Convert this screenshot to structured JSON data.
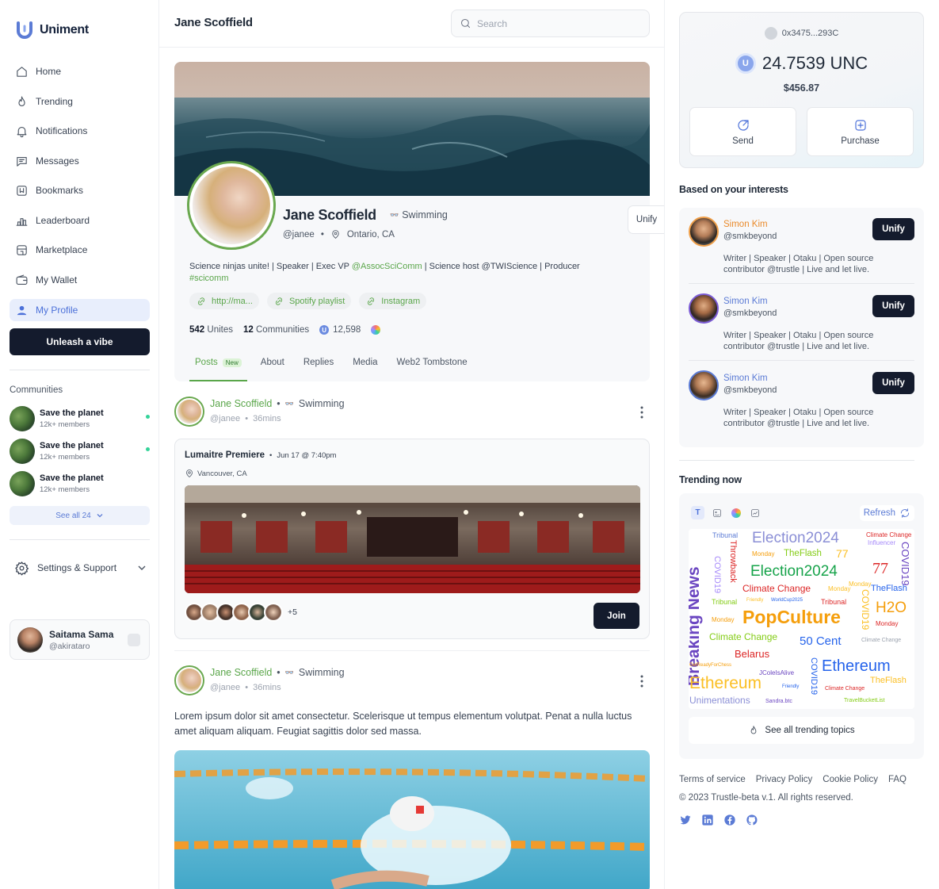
{
  "app": {
    "name": "Uniment"
  },
  "sidebar": {
    "nav": [
      {
        "label": "Home",
        "icon": "home-icon"
      },
      {
        "label": "Trending",
        "icon": "flame-icon"
      },
      {
        "label": "Notifications",
        "icon": "bell-icon"
      },
      {
        "label": "Messages",
        "icon": "message-icon"
      },
      {
        "label": "Bookmarks",
        "icon": "bookmark-icon"
      },
      {
        "label": "Leaderboard",
        "icon": "leaderboard-icon"
      },
      {
        "label": "Marketplace",
        "icon": "store-icon"
      },
      {
        "label": "My Wallet",
        "icon": "wallet-icon"
      },
      {
        "label": "My Profile",
        "icon": "user-icon"
      }
    ],
    "cta": "Unleash a vibe",
    "communities_title": "Communities",
    "communities": [
      {
        "name": "Save the planet",
        "members": "12k+ members",
        "online": true
      },
      {
        "name": "Save the planet",
        "members": "12k+ members",
        "online": true
      },
      {
        "name": "Save the planet",
        "members": "12k+ members",
        "online": false
      }
    ],
    "see_all": "See all 24",
    "settings": "Settings & Support",
    "user": {
      "name": "Saitama Sama",
      "handle": "@akirataro"
    }
  },
  "header": {
    "title": "Jane Scoffield",
    "search_placeholder": "Search"
  },
  "profile": {
    "name": "Jane Scoffield",
    "tag": "Swimming",
    "handle": "@janee",
    "location": "Ontario, CA",
    "unify": "Unify",
    "bio": {
      "part1": "Science ninjas unite! | Speaker | Exec VP ",
      "mention": "@AssocSciComm",
      "part2": " | Science host @TWIScience | Producer",
      "hashtag": "#scicomm"
    },
    "links": [
      "http://ma...",
      "Spotify playlist",
      "Instagram"
    ],
    "stats": {
      "unites": "542",
      "unites_label": "Unites",
      "communities": "12",
      "communities_label": "Communities",
      "tokens": "12,598"
    },
    "tabs": [
      "Posts",
      "About",
      "Replies",
      "Media",
      "Web2 Tombstone"
    ],
    "new_badge": "New"
  },
  "posts": [
    {
      "author": "Jane Scoffield",
      "tag": "Swimming",
      "handle": "@janee",
      "time": "36mins",
      "event": {
        "title": "Lumaitre Premiere",
        "date": "Jun 17 @ 7:40pm",
        "location": "Vancouver, CA",
        "more": "+5",
        "join": "Join"
      }
    },
    {
      "author": "Jane Scoffield",
      "tag": "Swimming",
      "handle": "@janee",
      "time": "36mins",
      "text": "Lorem ipsum dolor sit amet consectetur. Scelerisque ut tempus elementum volutpat. Penat a nulla luctus amet aliquam aliquam. Feugiat sagittis dolor sed massa."
    }
  ],
  "wallet": {
    "address": "0x3475...293C",
    "balance": "24.7539 UNC",
    "usd": "$456.87",
    "send": "Send",
    "purchase": "Purchase"
  },
  "interests": {
    "title": "Based on your interests",
    "items": [
      {
        "name": "Simon Kim",
        "handle": "@smkbeyond",
        "bio": "Writer | Speaker | Otaku | Open source contributor @trustle | Live and let live.",
        "button": "Unify"
      },
      {
        "name": "Simon Kim",
        "handle": "@smkbeyond",
        "bio": "Writer | Speaker | Otaku | Open source contributor @trustle | Live and let live.",
        "button": "Unify"
      },
      {
        "name": "Simon Kim",
        "handle": "@smkbeyond",
        "bio": "Writer | Speaker | Otaku | Open source contributor @trustle | Live and let live.",
        "button": "Unify"
      }
    ]
  },
  "trending": {
    "title": "Trending now",
    "refresh": "Refresh",
    "tool_t": "T",
    "see_all": "See all trending topics",
    "cloud": [
      {
        "t": "Breaking News",
        "c": "#6b46c1"
      },
      {
        "t": "Tribunal",
        "c": "#5b7bd5"
      },
      {
        "t": "Election2024",
        "c": "#8b8fd6"
      },
      {
        "t": "Climate Change",
        "c": "#dc2626"
      },
      {
        "t": "Monday",
        "c": "#f59e0b"
      },
      {
        "t": "TheFlash",
        "c": "#84cc16"
      },
      {
        "t": "77",
        "c": "#fbbf24"
      },
      {
        "t": "Influencer",
        "c": "#a78bfa"
      },
      {
        "t": "COVID19",
        "c": "#6b46c1"
      },
      {
        "t": "COVID19",
        "c": "#a78bfa"
      },
      {
        "t": "Throwback",
        "c": "#dc2626"
      },
      {
        "t": "Election2024",
        "c": "#16a34a"
      },
      {
        "t": "77",
        "c": "#dc2626"
      },
      {
        "t": "Monday",
        "c": "#fbbf24"
      },
      {
        "t": "TheFlash",
        "c": "#2563eb"
      },
      {
        "t": "Climate Change",
        "c": "#dc2626"
      },
      {
        "t": "Monday",
        "c": "#fbbf24"
      },
      {
        "t": "Tribunal",
        "c": "#84cc16"
      },
      {
        "t": "Friendly",
        "c": "#fbbf24"
      },
      {
        "t": "WorldCup2025",
        "c": "#2563eb"
      },
      {
        "t": "Tribunal",
        "c": "#dc2626"
      },
      {
        "t": "COVID19",
        "c": "#fbbf24"
      },
      {
        "t": "Monday",
        "c": "#f59e0b"
      },
      {
        "t": "PopCulture",
        "c": "#f59e0b"
      },
      {
        "t": "H2O",
        "c": "#f59e0b"
      },
      {
        "t": "Monday",
        "c": "#dc2626"
      },
      {
        "t": "Climate Change",
        "c": "#84cc16"
      },
      {
        "t": "50 Cent",
        "c": "#2563eb"
      },
      {
        "t": "Climate Change",
        "c": "#9ca3af"
      },
      {
        "t": "Belarus",
        "c": "#dc2626"
      },
      {
        "t": "COVID19",
        "c": "#2563eb"
      },
      {
        "t": "Ethereum",
        "c": "#2563eb"
      },
      {
        "t": "GetReadyForChess",
        "c": "#f59e0b"
      },
      {
        "t": "JColeIsAlive",
        "c": "#6b46c1"
      },
      {
        "t": "Ethereum",
        "c": "#fbbf24"
      },
      {
        "t": "TheFlash",
        "c": "#fbbf24"
      },
      {
        "t": "Friendly",
        "c": "#2563eb"
      },
      {
        "t": "Climate Change",
        "c": "#dc2626"
      },
      {
        "t": "Unimentations",
        "c": "#8b8fd6"
      },
      {
        "t": "Sandra.btc",
        "c": "#6b46c1"
      },
      {
        "t": "TravelBucketList",
        "c": "#84cc16"
      }
    ]
  },
  "footer": {
    "links": [
      "Terms of service",
      "Privacy Policy",
      "Cookie Policy",
      "FAQ"
    ],
    "copyright": "© 2023 Trustle-beta v.1. All rights reserved."
  },
  "colors": {
    "accent": "#4c71d9",
    "green": "#5aa64a",
    "dark": "#141b2d",
    "orange": "#ea8a2a"
  }
}
